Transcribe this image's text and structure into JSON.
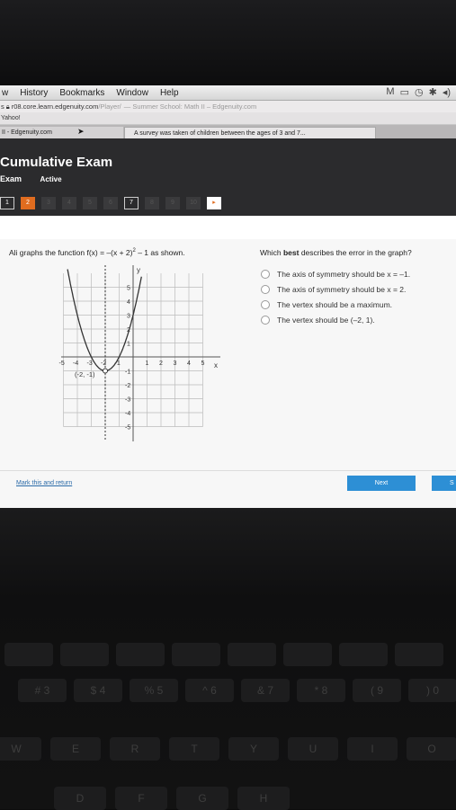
{
  "browser": {
    "menu": [
      "w",
      "History",
      "Bookmarks",
      "Window",
      "Help"
    ],
    "url_prefix": "s",
    "url": "r08.core.learn.edgenuity.com",
    "url_path": "/Player/",
    "page_title_dim": "— Summer School: Math II – Edgenuity.com",
    "bookmark": "Yahoo!",
    "tab1": "II - Edgenuity.com",
    "tab2": "A survey was taken of children between the ages of 3 and 7..."
  },
  "header": {
    "title": "Cumulative Exam",
    "sub": "Exam",
    "status": "Active",
    "questions": [
      {
        "label": "1",
        "state": "done"
      },
      {
        "label": "2",
        "state": "current"
      },
      {
        "label": "3",
        "state": "locked"
      },
      {
        "label": "4",
        "state": "locked"
      },
      {
        "label": "5",
        "state": "locked"
      },
      {
        "label": "6",
        "state": "locked"
      },
      {
        "label": "7",
        "state": "done"
      },
      {
        "label": "8",
        "state": "locked"
      },
      {
        "label": "9",
        "state": "locked"
      },
      {
        "label": "10",
        "state": "locked"
      }
    ],
    "next_arrow": "▸"
  },
  "question": {
    "stem_a": "Ali graphs the function f(x) = –(x + 2)",
    "stem_exp": "2",
    "stem_b": " – 1 as shown.",
    "prompt_a": "Which ",
    "prompt_b": "best",
    "prompt_c": " describes the error in the graph?",
    "options": [
      "The axis of symmetry should be x = –1.",
      "The axis of symmetry should be x = 2.",
      "The vertex should be a maximum.",
      "The vertex should be (–2, 1)."
    ]
  },
  "graph": {
    "x_label": "x",
    "y_label": "y",
    "x_ticks": [
      "-5",
      "-4",
      "-3",
      "-2",
      "-1",
      "1",
      "2",
      "3",
      "4",
      "5"
    ],
    "y_ticks": [
      "5",
      "4",
      "3",
      "2",
      "1",
      "-1",
      "-2",
      "-3",
      "-4",
      "-5"
    ],
    "vertex_label": "(-2, -1)",
    "curve_vertex": [
      -2,
      -1
    ],
    "opens": "up",
    "axis_of_symmetry_x": -2
  },
  "footer": {
    "mark_label": "Mark this and return",
    "next_label": "Next",
    "submit_label": "S"
  },
  "keyboard": {
    "row2": [
      "#",
      "$",
      "%",
      "^",
      "&",
      "*",
      "(",
      ")"
    ],
    "row2_nums": [
      "3",
      "4",
      "5",
      "6",
      "7",
      "8",
      "9",
      "0"
    ],
    "row3": [
      "W",
      "E",
      "R",
      "T",
      "Y",
      "U",
      "I",
      "O"
    ],
    "row4": [
      "D",
      "F",
      "G",
      "H"
    ]
  }
}
